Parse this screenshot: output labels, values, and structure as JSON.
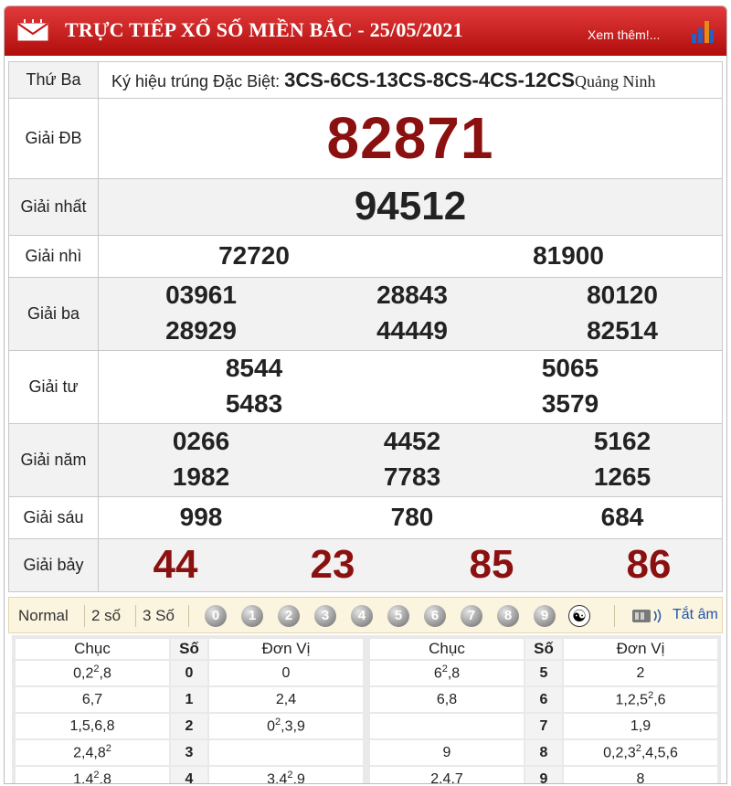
{
  "header": {
    "title": "TRỰC TIẾP XỔ SỐ MIỀN BẮC - 25/05/2021",
    "more_link": "Xem thêm!..."
  },
  "info": {
    "day": "Thứ Ba",
    "symbol_label": "Ký hiệu trúng Đặc Biệt:",
    "symbol_value": "3CS-6CS-13CS-8CS-4CS-12CS",
    "province": "Quảng Ninh"
  },
  "prizes": {
    "db": {
      "label": "Giải ĐB",
      "numbers": [
        "82871"
      ]
    },
    "g1": {
      "label": "Giải nhất",
      "numbers": [
        "94512"
      ]
    },
    "g2": {
      "label": "Giải nhì",
      "numbers": [
        "72720",
        "81900"
      ]
    },
    "g3": {
      "label": "Giải ba",
      "numbers": [
        "03961",
        "28843",
        "80120",
        "28929",
        "44449",
        "82514"
      ]
    },
    "g4": {
      "label": "Giải tư",
      "numbers": [
        "8544",
        "5065",
        "5483",
        "3579"
      ]
    },
    "g5": {
      "label": "Giải năm",
      "numbers": [
        "0266",
        "4452",
        "5162",
        "1982",
        "7783",
        "1265"
      ]
    },
    "g6": {
      "label": "Giải sáu",
      "numbers": [
        "998",
        "780",
        "684"
      ]
    },
    "g7": {
      "label": "Giải bảy",
      "numbers": [
        "44",
        "23",
        "85",
        "86"
      ]
    }
  },
  "toolbar": {
    "modes": [
      "Normal",
      "2 số",
      "3 Số"
    ],
    "digits": [
      "0",
      "1",
      "2",
      "3",
      "4",
      "5",
      "6",
      "7",
      "8",
      "9"
    ],
    "yin_yang": "☯",
    "mute_label": "Tắt âm"
  },
  "loto": {
    "headers": {
      "chuc": "Chục",
      "so": "Số",
      "donvi": "Đơn Vị"
    },
    "rows": [
      {
        "chuc": "0,2<sup>2</sup>,8",
        "so": "0",
        "donvi": "0"
      },
      {
        "chuc": "6,7",
        "so": "1",
        "donvi": "2,4"
      },
      {
        "chuc": "1,5,6,8",
        "so": "2",
        "donvi": "0<sup>2</sup>,3,9"
      },
      {
        "chuc": "2,4,8<sup>2</sup>",
        "so": "3",
        "donvi": ""
      },
      {
        "chuc": "1,4<sup>2</sup>,8",
        "so": "4",
        "donvi": "3,4<sup>2</sup>,9"
      },
      {
        "chuc": "6<sup>2</sup>,8",
        "so": "5",
        "donvi": "2"
      },
      {
        "chuc": "6,8",
        "so": "6",
        "donvi": "1,2,5<sup>2</sup>,6"
      },
      {
        "chuc": "",
        "so": "7",
        "donvi": "1,9"
      },
      {
        "chuc": "9",
        "so": "8",
        "donvi": "0,2,3<sup>2</sup>,4,5,6"
      },
      {
        "chuc": "2,4,7",
        "so": "9",
        "donvi": "8"
      }
    ]
  }
}
